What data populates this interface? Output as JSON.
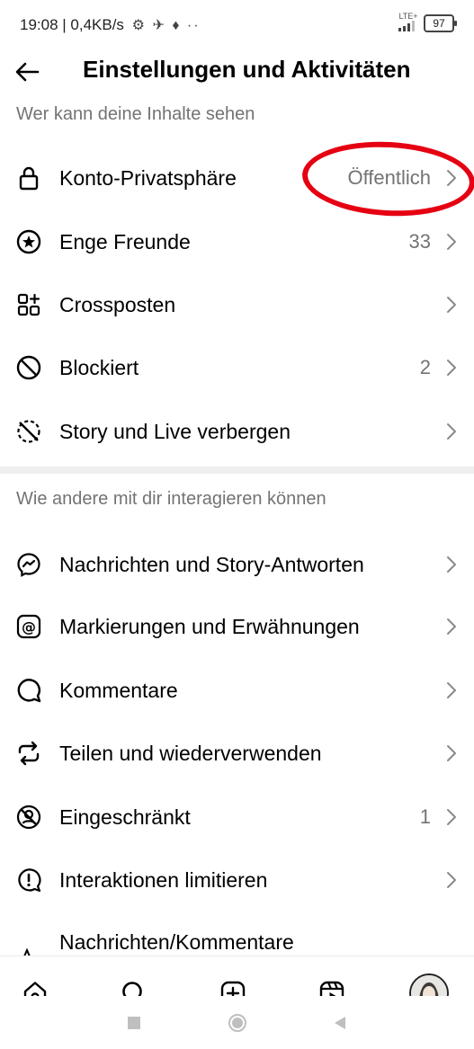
{
  "status_bar": {
    "time_info": "19:08 | 0,4KB/s",
    "notification_glyphs": "⚙ ✈ ♦ ··",
    "network": "LTE+",
    "battery": "97"
  },
  "header": {
    "back_icon": "arrow-left-icon",
    "title": "Einstellungen und Aktivitäten"
  },
  "sections": [
    {
      "title": "Wer kann deine Inhalte sehen",
      "items": [
        {
          "label": "Konto-Privatsphäre",
          "value": "Öffentlich",
          "icon": "lock-icon"
        },
        {
          "label": "Enge Freunde",
          "value": "33",
          "icon": "close-friends-star-icon"
        },
        {
          "label": "Crossposten",
          "value": "",
          "icon": "crossposting-icon"
        },
        {
          "label": "Blockiert",
          "value": "2",
          "icon": "blocked-icon"
        },
        {
          "label": "Story und Live verbergen",
          "value": "",
          "icon": "hide-story-icon"
        }
      ]
    },
    {
      "title": "Wie andere mit dir interagieren können",
      "items": [
        {
          "label": "Nachrichten und Story-Antworten",
          "value": "",
          "icon": "messenger-icon"
        },
        {
          "label": "Markierungen und Erwähnungen",
          "value": "",
          "icon": "at-mention-icon"
        },
        {
          "label": "Kommentare",
          "value": "",
          "icon": "comment-icon"
        },
        {
          "label": "Teilen und wiederverwenden",
          "value": "",
          "icon": "share-reuse-icon"
        },
        {
          "label": "Eingeschränkt",
          "value": "1",
          "icon": "restricted-icon"
        },
        {
          "label": "Interaktionen limitieren",
          "value": "",
          "icon": "limit-interactions-icon"
        },
        {
          "label": "Nachrichten/Kommentare",
          "value": "",
          "icon": "hidden-words-icon"
        }
      ]
    }
  ],
  "tab_bar": {
    "items": [
      "home-icon",
      "search-icon",
      "create-icon",
      "reels-icon",
      "profile-avatar"
    ]
  },
  "system_nav": {
    "items": [
      "recents-square-icon",
      "home-circle-icon",
      "back-triangle-icon"
    ]
  },
  "colors": {
    "highlight": "#e50012",
    "secondary_text": "#737373",
    "divider": "#efefef"
  }
}
